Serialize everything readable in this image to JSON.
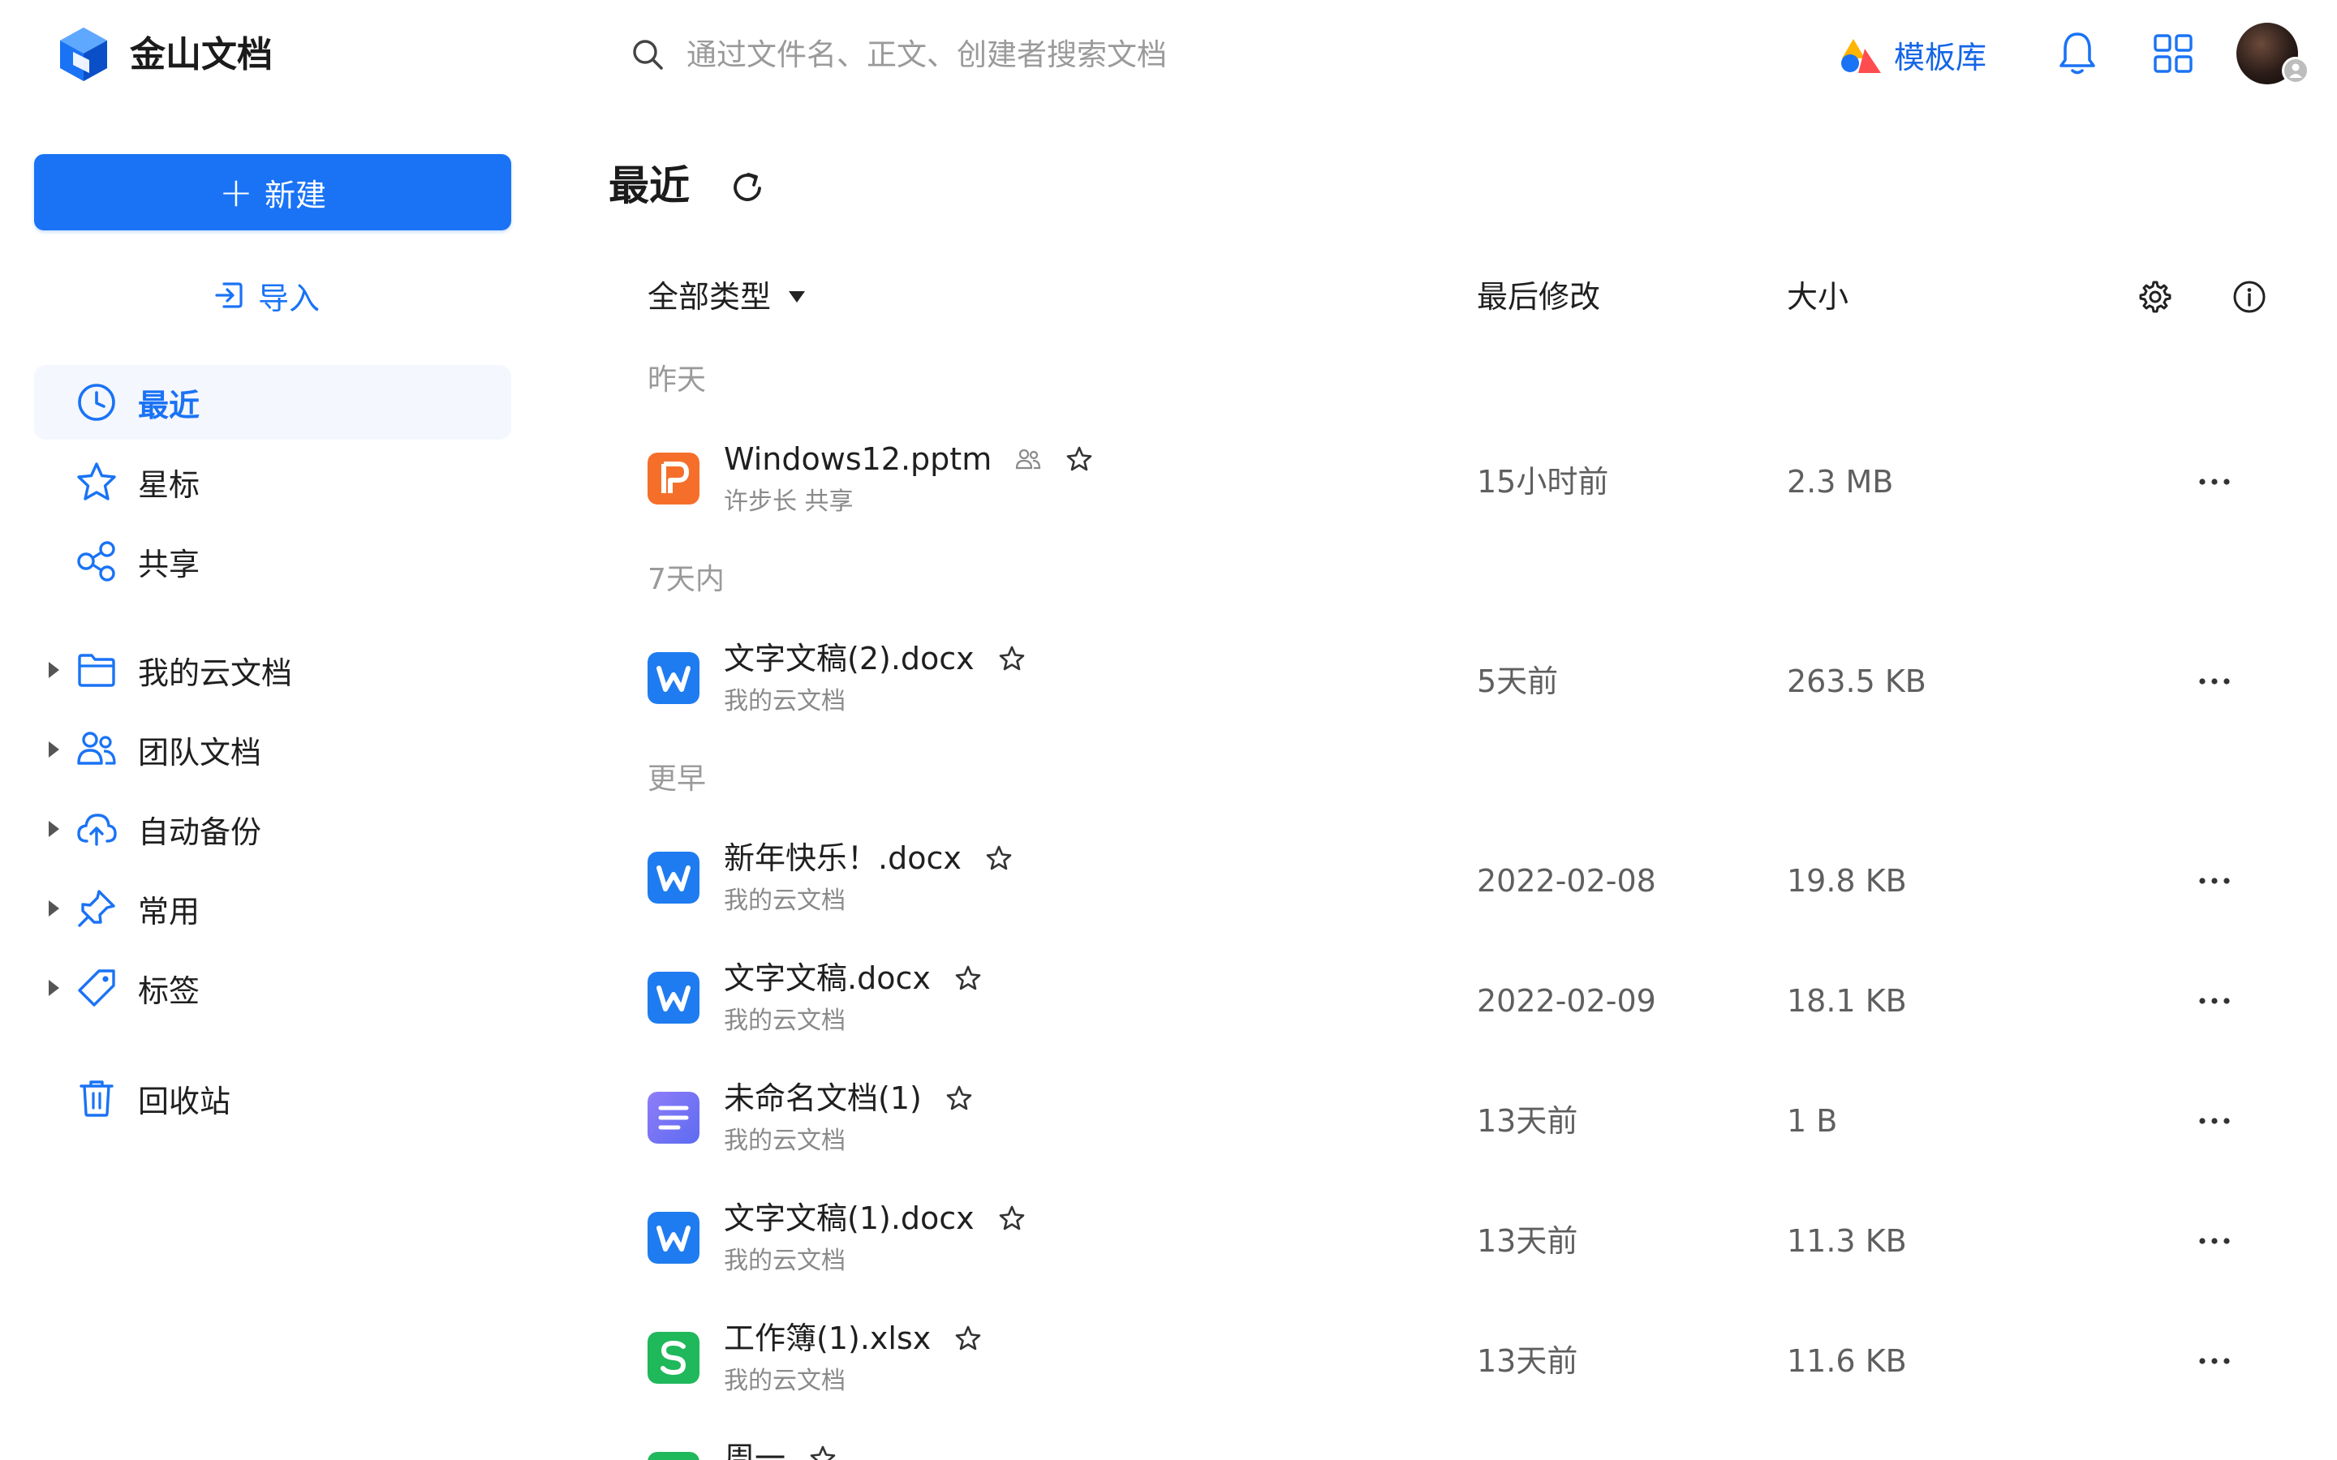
{
  "header": {
    "app_name": "金山文档",
    "search_placeholder": "通过文件名、正文、创建者搜索文档",
    "template_label": "模板库"
  },
  "sidebar": {
    "new_label": "新建",
    "import_label": "导入",
    "items": [
      {
        "label": "最近",
        "icon": "clock-icon",
        "active": true
      },
      {
        "label": "星标",
        "icon": "star-icon"
      },
      {
        "label": "共享",
        "icon": "share-icon"
      },
      {
        "label": "我的云文档",
        "icon": "folder-icon",
        "expandable": true
      },
      {
        "label": "团队文档",
        "icon": "team-icon",
        "expandable": true
      },
      {
        "label": "自动备份",
        "icon": "cloud-upload-icon",
        "expandable": true
      },
      {
        "label": "常用",
        "icon": "pin-icon",
        "expandable": true
      },
      {
        "label": "标签",
        "icon": "tag-icon",
        "expandable": true
      },
      {
        "label": "回收站",
        "icon": "trash-icon"
      }
    ]
  },
  "main": {
    "title": "最近",
    "columns": {
      "type_filter": "全部类型",
      "modified": "最后修改",
      "size": "大小"
    },
    "groups": [
      "昨天",
      "7天内",
      "更早"
    ],
    "files": [
      {
        "name": "Windows12.pptm",
        "sub": "许步长 共享",
        "modified": "15小时前",
        "size": "2.3 MB",
        "kind": "pptx",
        "letter": "P",
        "color": "#f56f2a",
        "shared": true
      },
      {
        "name": "文字文稿(2).docx",
        "sub": "我的云文档",
        "modified": "5天前",
        "size": "263.5 KB",
        "kind": "docx",
        "letter": "W",
        "color": "#1f7cf0"
      },
      {
        "name": "新年快乐！.docx",
        "sub": "我的云文档",
        "modified": "2022-02-08",
        "size": "19.8 KB",
        "kind": "docx",
        "letter": "W",
        "color": "#1f7cf0"
      },
      {
        "name": "文字文稿.docx",
        "sub": "我的云文档",
        "modified": "2022-02-09",
        "size": "18.1 KB",
        "kind": "docx",
        "letter": "W",
        "color": "#1f7cf0"
      },
      {
        "name": "未命名文档(1)",
        "sub": "我的云文档",
        "modified": "13天前",
        "size": "1 B",
        "kind": "note",
        "letter": "",
        "color": "#7b6cf6"
      },
      {
        "name": "文字文稿(1).docx",
        "sub": "我的云文档",
        "modified": "13天前",
        "size": "11.3 KB",
        "kind": "docx",
        "letter": "W",
        "color": "#1f7cf0"
      },
      {
        "name": "工作簿(1).xlsx",
        "sub": "我的云文档",
        "modified": "13天前",
        "size": "11.6 KB",
        "kind": "xlsx",
        "letter": "S",
        "color": "#1fb85a"
      },
      {
        "name": "周一",
        "sub": "",
        "modified": "",
        "size": "",
        "kind": "xlsx",
        "letter": "",
        "color": "#1fb85a"
      }
    ]
  },
  "colors": {
    "accent": "#1a73f5",
    "active_bg": "#f4f7fd",
    "muted_text": "#9a9a9a"
  }
}
